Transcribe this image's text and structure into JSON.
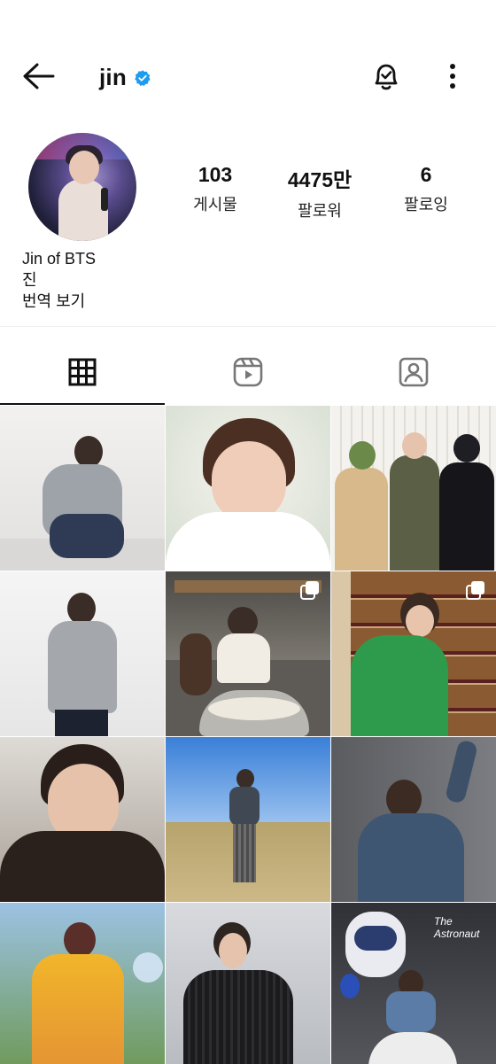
{
  "header": {
    "back_icon": "arrow-left-icon",
    "username": "jin",
    "verified_icon": "verified-badge-icon",
    "notification_icon": "bell-check-icon",
    "more_icon": "more-vertical-icon",
    "verified_color": "#1D9BF0"
  },
  "profile": {
    "stats": [
      {
        "value": "103",
        "label": "게시물"
      },
      {
        "value": "4475만",
        "label": "팔로워"
      },
      {
        "value": "6",
        "label": "팔로잉"
      }
    ],
    "bio_name": "Jin of BTS",
    "bio_text": "진",
    "translate_label": "번역 보기"
  },
  "tabs": [
    {
      "icon": "grid-icon",
      "active": true
    },
    {
      "icon": "reels-icon",
      "active": false
    },
    {
      "icon": "tagged-icon",
      "active": false
    }
  ],
  "posts": [
    {
      "subject": "man crouching in grey sweater",
      "multi": false
    },
    {
      "subject": "selfie resting chin on hand",
      "multi": false
    },
    {
      "subject": "three men posing, one in military uniform",
      "multi": false
    },
    {
      "subject": "man standing in grey sweater",
      "multi": false
    },
    {
      "subject": "man in kitchen with large bowl of rice",
      "multi": true
    },
    {
      "subject": "man in green sweater by shelves of bottles",
      "multi": true
    },
    {
      "subject": "close-up in leather jacket",
      "multi": false
    },
    {
      "subject": "man standing on grassy hill under blue sky",
      "multi": false
    },
    {
      "subject": "man in denim jacket raising arm",
      "multi": false
    },
    {
      "subject": "man in yellow sweater in garden",
      "multi": false
    },
    {
      "subject": "man in black pleated jacket",
      "multi": false
    },
    {
      "subject": "man seated with astronaut balloon",
      "multi": false
    }
  ],
  "poster_text": "The Astronaut"
}
